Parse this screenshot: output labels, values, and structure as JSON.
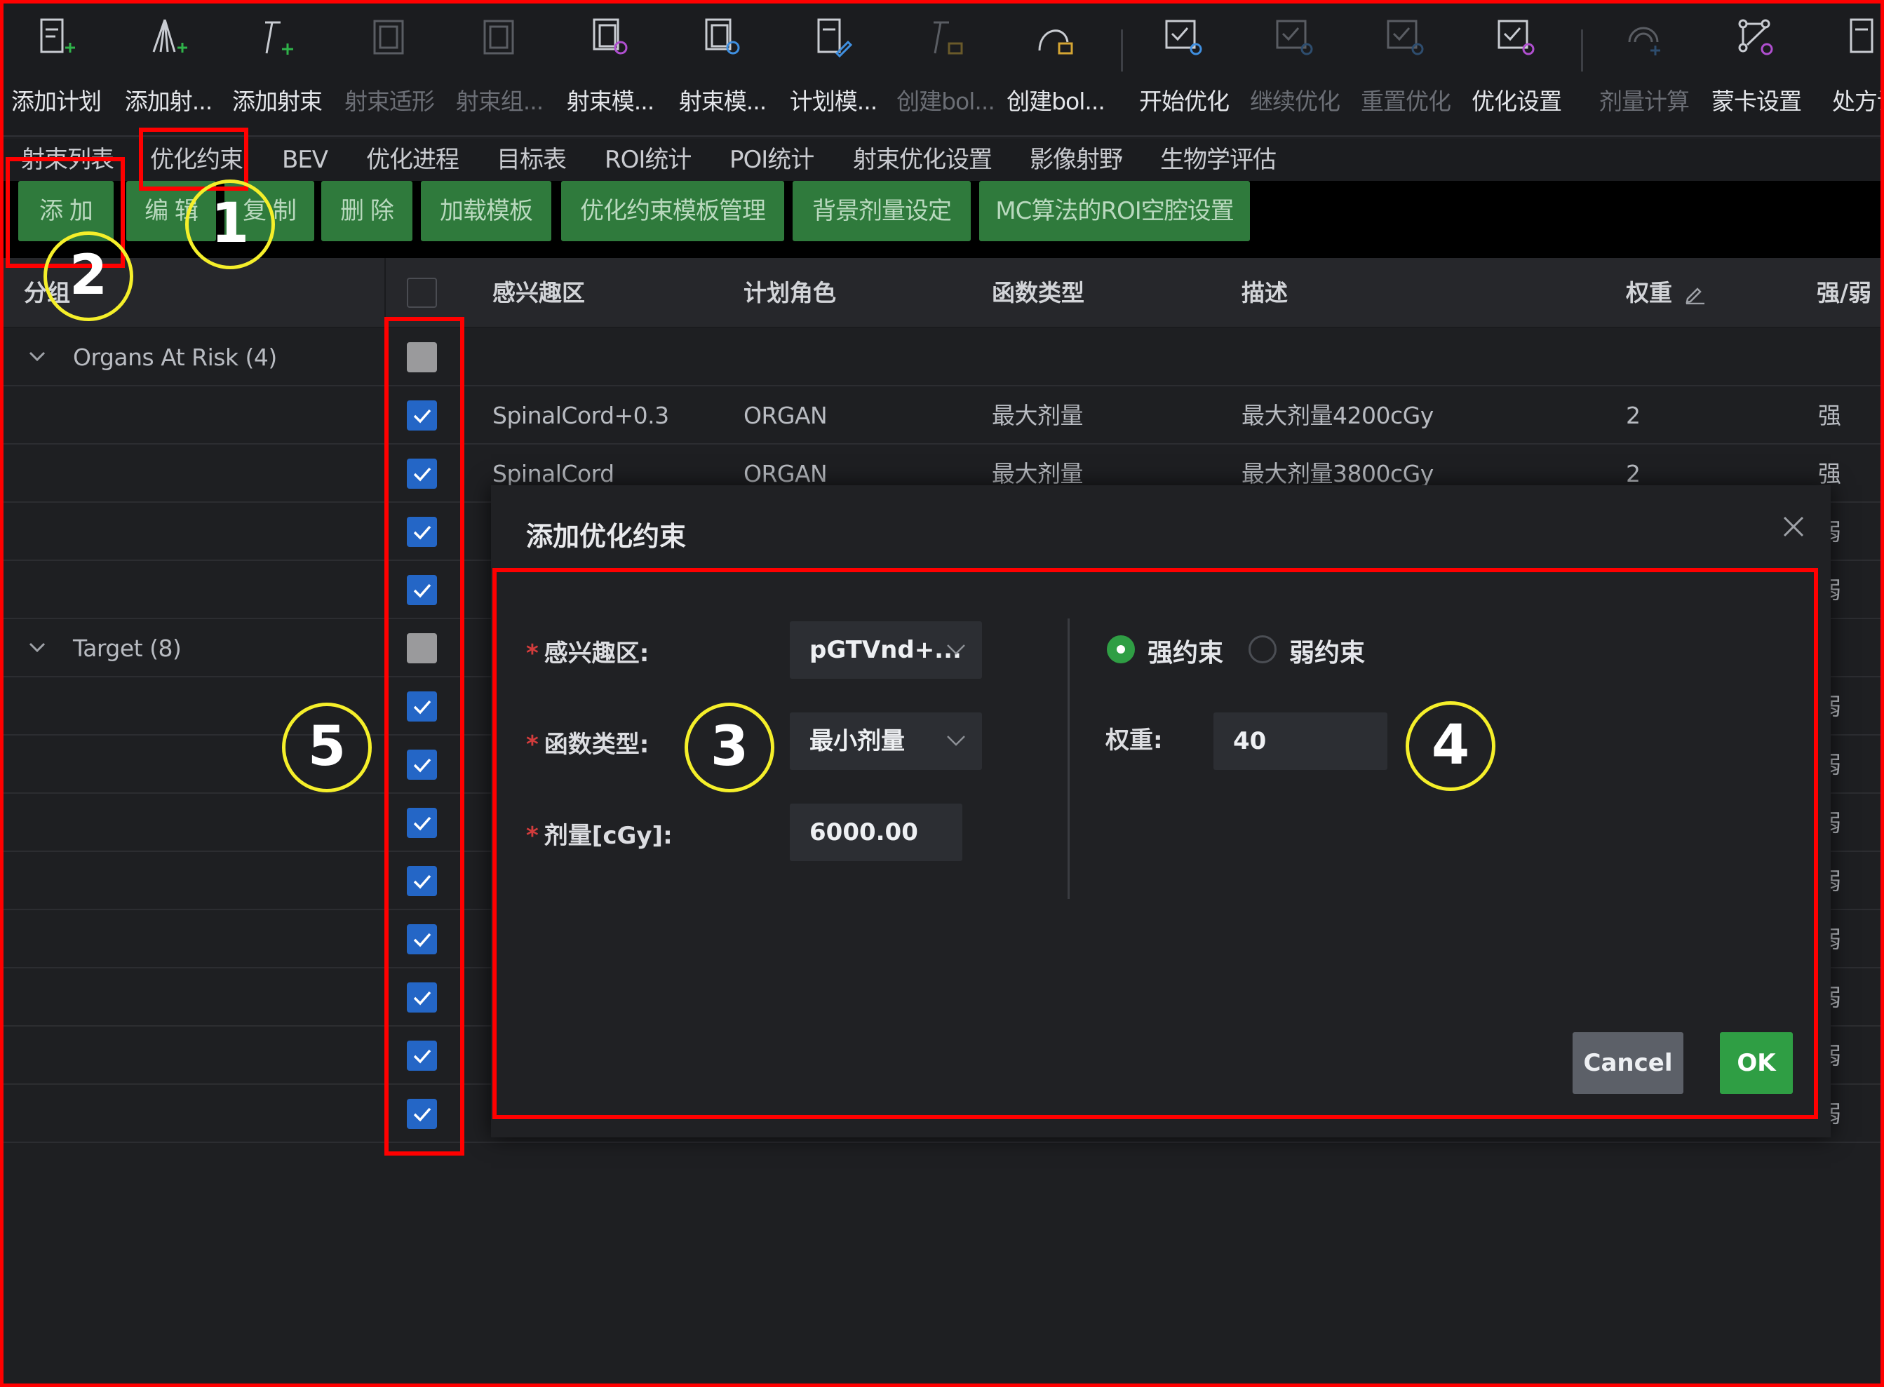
{
  "toolbar": {
    "items": [
      {
        "label": "添加计划",
        "icon": "add-plan-icon",
        "enabled": true
      },
      {
        "label": "添加射...",
        "icon": "add-beam-fan-icon",
        "enabled": true
      },
      {
        "label": "添加射束",
        "icon": "add-beam-icon",
        "enabled": true
      },
      {
        "label": "射束适形",
        "icon": "beam-conform-icon",
        "enabled": false
      },
      {
        "label": "射束组...",
        "icon": "beam-group-icon",
        "enabled": false
      },
      {
        "label": "射束模...",
        "icon": "beam-template-icon",
        "enabled": true
      },
      {
        "label": "射束模...",
        "icon": "beam-template-edit-icon",
        "enabled": true
      },
      {
        "label": "计划模...",
        "icon": "plan-template-icon",
        "enabled": true
      },
      {
        "label": "创建bol...",
        "icon": "create-bolus-icon",
        "enabled": false
      },
      {
        "label": "创建bol...",
        "icon": "create-bolus-shape-icon",
        "enabled": true
      },
      {
        "label": "开始优化",
        "icon": "start-optimize-icon",
        "enabled": true
      },
      {
        "label": "继续优化",
        "icon": "continue-optimize-icon",
        "enabled": false
      },
      {
        "label": "重置优化",
        "icon": "reset-optimize-icon",
        "enabled": false
      },
      {
        "label": "优化设置",
        "icon": "optimize-settings-icon",
        "enabled": true
      },
      {
        "label": "剂量计算",
        "icon": "dose-calc-icon",
        "enabled": false
      },
      {
        "label": "蒙卡设置",
        "icon": "monte-carlo-settings-icon",
        "enabled": true
      },
      {
        "label": "处方设",
        "icon": "prescription-icon",
        "enabled": true
      }
    ]
  },
  "tabs": [
    "射束列表",
    "优化约束",
    "BEV",
    "优化进程",
    "目标表",
    "ROI统计",
    "POI统计",
    "射束优化设置",
    "影像射野",
    "生物学评估"
  ],
  "actions": [
    "添 加",
    "编 辑",
    "复 制",
    "删 除",
    "加载模板",
    "优化约束模板管理",
    "背景剂量设定",
    "MC算法的ROI空腔设置"
  ],
  "table": {
    "headers": {
      "group": "分组",
      "roi": "感兴趣区",
      "role": "计划角色",
      "func": "函数类型",
      "desc": "描述",
      "weight": "权重",
      "strength": "强/弱"
    },
    "groups": [
      {
        "label": "Organs At Risk (4)",
        "rows": [
          {
            "roi": "SpinalCord+0.3",
            "role": "ORGAN",
            "func": "最大剂量",
            "desc": "最大剂量4200cGy",
            "weight": "2",
            "strength": "强"
          },
          {
            "roi": "SpinalCord",
            "role": "ORGAN",
            "func": "最大剂量",
            "desc": "最大剂量3800cGy",
            "weight": "2",
            "strength": "强"
          },
          {
            "roi": "",
            "role": "",
            "func": "",
            "desc": "",
            "weight": "",
            "strength": "弱"
          },
          {
            "roi": "",
            "role": "",
            "func": "",
            "desc": "",
            "weight": "",
            "strength": "弱"
          }
        ]
      },
      {
        "label": "Target (8)",
        "rows": [
          {
            "strength": "弱"
          },
          {
            "strength": "弱"
          },
          {
            "strength": "弱"
          },
          {
            "strength": "弱"
          },
          {
            "strength": "弱"
          },
          {
            "strength": "弱"
          },
          {
            "strength": "弱"
          },
          {
            "strength": "弱"
          }
        ]
      }
    ]
  },
  "modal": {
    "title": "添加优化约束",
    "close_glyph": "X",
    "roi_label": "感兴趣区:",
    "roi_value": "pGTVnd+...",
    "func_label": "函数类型:",
    "func_value": "最小剂量",
    "dose_label": "剂量[cGy]:",
    "dose_value": "6000.00",
    "required_mark": "*",
    "strong_label": "强约束",
    "weak_label": "弱约束",
    "strong_selected": true,
    "weight_label": "权重:",
    "weight_value": "40",
    "cancel_label": "Cancel",
    "ok_label": "OK"
  },
  "annotations": [
    "1",
    "2",
    "3",
    "4",
    "5"
  ],
  "colors": {
    "accent_green": "#2f9e44",
    "button_green": "#2f7a3c",
    "checkbox_blue": "#2466c6",
    "annotation_red": "#ff0000",
    "callout_yellow": "#f5ef2a"
  }
}
